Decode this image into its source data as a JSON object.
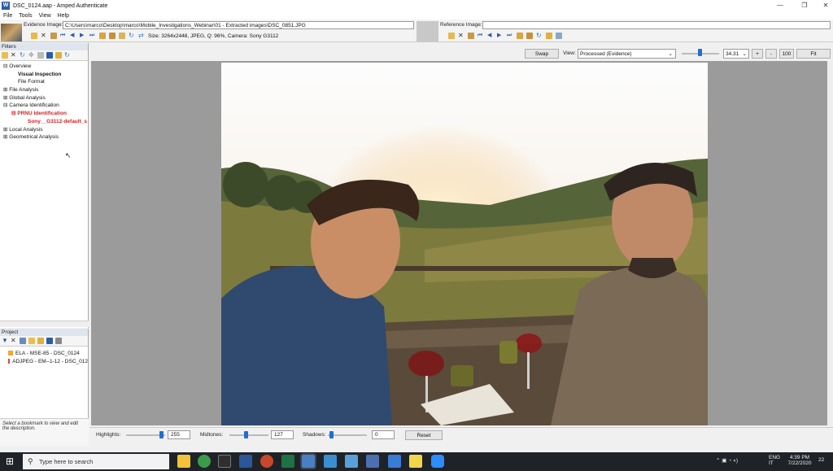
{
  "window": {
    "title": "DSC_0124.aap - Amped Authenticate",
    "min": "—",
    "max": "❐",
    "close": "✕"
  },
  "menu": [
    "File",
    "Tools",
    "View",
    "Help"
  ],
  "evidence": {
    "label": "Evidence Image:",
    "path": "C:\\Users\\marco\\Desktop\\marco\\Mobile_Investigations_Webinar\\01 - Extracted images\\DSC_0851.JPG",
    "info": "Size: 3264x2448, JPEG, Q: 96%, Camera: Sony G3112"
  },
  "reference": {
    "label": "Reference Image:",
    "path": ""
  },
  "filters": {
    "header": "Filters",
    "tree": [
      {
        "label": "Overview",
        "indent": 0,
        "prefix": "⊟",
        "style": ""
      },
      {
        "label": "Visual Inspection",
        "indent": 1,
        "prefix": "",
        "style": "bold"
      },
      {
        "label": "File Format",
        "indent": 1,
        "prefix": "",
        "style": ""
      },
      {
        "label": "File Analysis",
        "indent": 0,
        "prefix": "⊞",
        "style": ""
      },
      {
        "label": "Global Analysis",
        "indent": 0,
        "prefix": "⊞",
        "style": ""
      },
      {
        "label": "Camera Identification",
        "indent": 0,
        "prefix": "⊟",
        "style": ""
      },
      {
        "label": "PRNU Identification",
        "indent": 1,
        "prefix": "⊟",
        "style": "red"
      },
      {
        "label": "Sony__G3112-default_s",
        "indent": 2,
        "prefix": "",
        "style": "redn"
      },
      {
        "label": "Local Analysis",
        "indent": 0,
        "prefix": "⊞",
        "style": ""
      },
      {
        "label": "Geometrical Analysis",
        "indent": 0,
        "prefix": "⊞",
        "style": ""
      }
    ]
  },
  "project": {
    "header": "Project",
    "items": [
      {
        "label": "ELA - MSE-85 - DSC_0124",
        "color": "#f0a830"
      },
      {
        "label": "ADJPEG - EM--1-12 - DSC_012",
        "color": "#d94a2a"
      }
    ]
  },
  "description": "Select a bookmark to view and edit the description.",
  "viewer": {
    "swap": "Swap",
    "view_label": "View:",
    "view_value": "Processed (Evidence)",
    "zoom": "34.31",
    "plus": "+",
    "minus": "-",
    "hundred": "100",
    "fit": "Fit"
  },
  "adjust": {
    "highlights_label": "Highlights:",
    "highlights": "255",
    "midtones_label": "Midtones:",
    "midtones": "127",
    "shadows_label": "Shadows:",
    "shadows": "0",
    "reset": "Reset"
  },
  "taskbar": {
    "search_placeholder": "Type here to search",
    "lang": "ENG",
    "region": "IT",
    "time": "4:39 PM",
    "date": "7/22/2020",
    "notif": "22",
    "apps": [
      {
        "name": "file-explorer-icon",
        "color": "#f3c13a"
      },
      {
        "name": "chrome-icon",
        "color": "#3b9b4b"
      },
      {
        "name": "terminal-icon",
        "color": "#2f2f2f"
      },
      {
        "name": "word-icon",
        "color": "#2b579a"
      },
      {
        "name": "powerpoint-icon",
        "color": "#c9482b"
      },
      {
        "name": "excel-icon",
        "color": "#1e7145"
      },
      {
        "name": "amped-authenticate-icon",
        "color": "#4a7fc4"
      },
      {
        "name": "amped-five-icon",
        "color": "#3a8fd0"
      },
      {
        "name": "amped-replay-icon",
        "color": "#5aa0d8"
      },
      {
        "name": "amped-dvr-icon",
        "color": "#4c6fb0"
      },
      {
        "name": "mail-icon",
        "color": "#3a7bd5"
      },
      {
        "name": "sticky-notes-icon",
        "color": "#f2d64a"
      },
      {
        "name": "zoom-icon",
        "color": "#2d8cff"
      }
    ]
  }
}
